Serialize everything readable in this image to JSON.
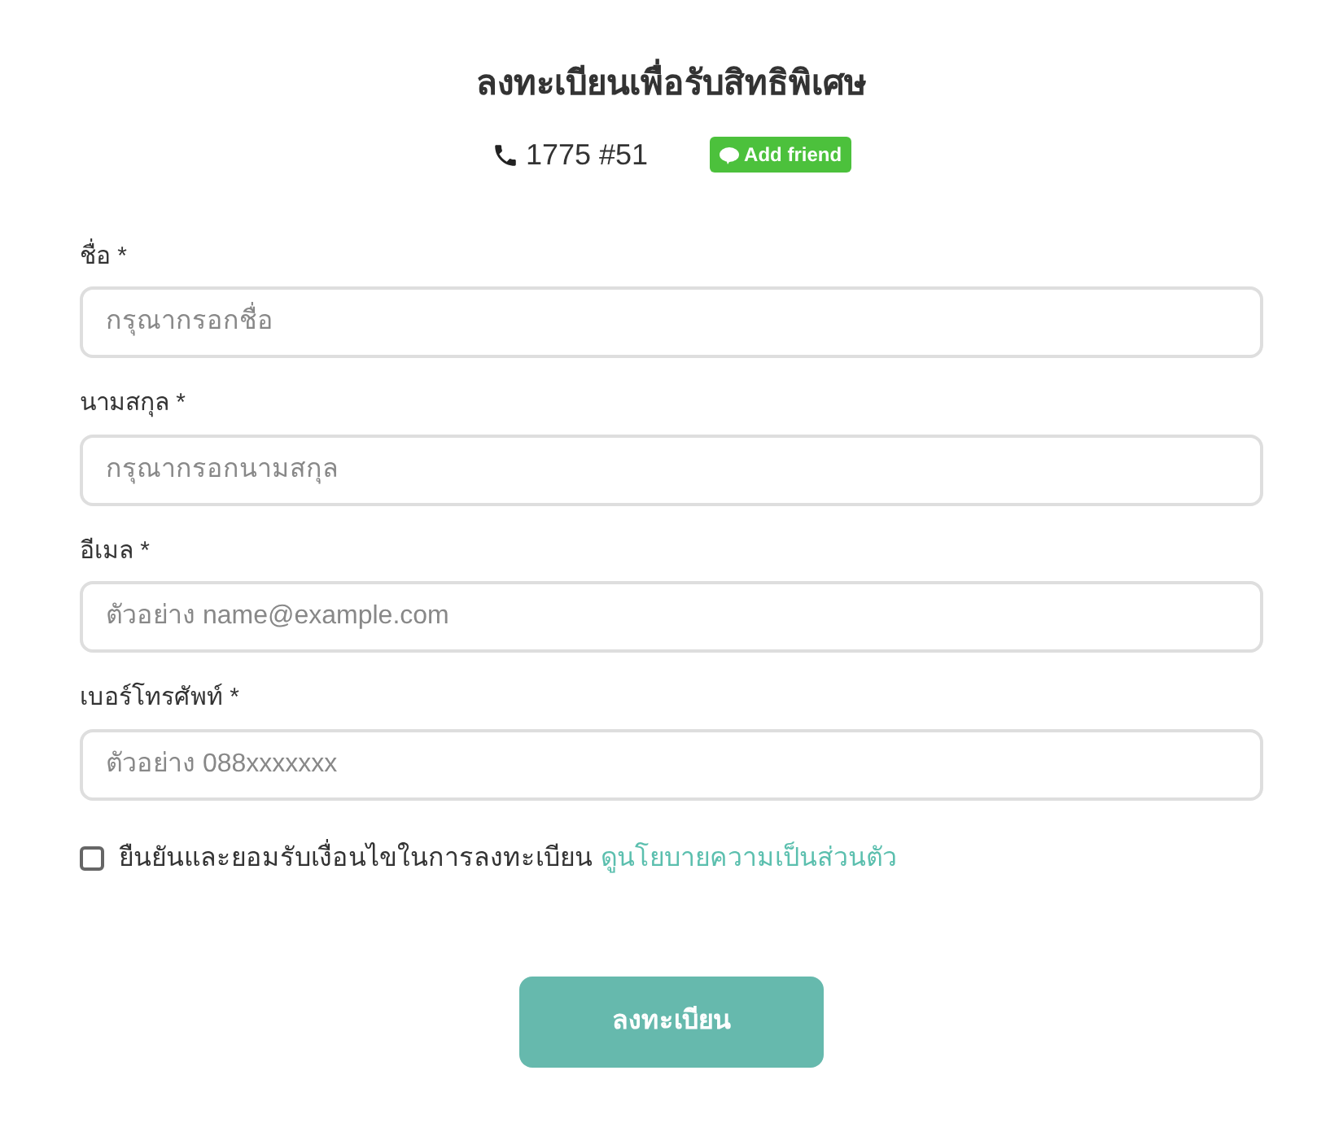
{
  "title": "ลงทะเบียนเพื่อรับสิทธิพิเศษ",
  "contact": {
    "phone": "1775 #51",
    "add_friend": "Add friend"
  },
  "fields": [
    {
      "label": "ชื่อ *",
      "placeholder": "กรุณากรอกชื่อ"
    },
    {
      "label": "นามสกุล *",
      "placeholder": "กรุณากรอกนามสกุล"
    },
    {
      "label": "อีเมล *",
      "placeholder": "ตัวอย่าง name@example.com"
    },
    {
      "label": "เบอร์โทรศัพท์ *",
      "placeholder": "ตัวอย่าง 088xxxxxxx"
    }
  ],
  "consent": {
    "checked": false,
    "text": "ยืนยันและยอมรับเงื่อนไขในการลงทะเบียน",
    "link": "ดูนโยบายความเป็นส่วนตัว"
  },
  "submit": "ลงทะเบียน"
}
